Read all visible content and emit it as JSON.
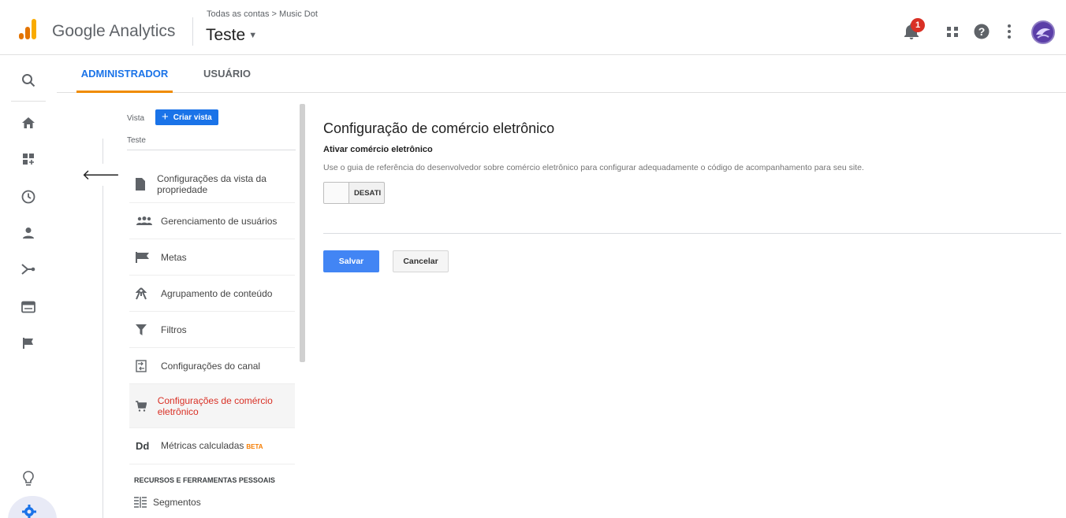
{
  "header": {
    "product_name": "Google Analytics",
    "breadcrumb": "Todas as contas > Music Dot",
    "view_name": "Teste",
    "notification_count": "1",
    "logo_colors": [
      "#F9AB00",
      "#E37400",
      "#E37400"
    ]
  },
  "tabs": {
    "admin": "ADMINISTRADOR",
    "user": "USUÁRIO"
  },
  "view_column": {
    "label": "Vista",
    "create_button": "Criar vista",
    "selected_view": "Teste",
    "menu": [
      {
        "label": "Configurações da vista da propriedade",
        "icon": "document-icon"
      },
      {
        "label": "Gerenciamento de usuários",
        "icon": "users-icon"
      },
      {
        "label": "Metas",
        "icon": "flag-icon"
      },
      {
        "label": "Agrupamento de conteúdo",
        "icon": "content-grouping-icon"
      },
      {
        "label": "Filtros",
        "icon": "filter-icon"
      },
      {
        "label": "Configurações do canal",
        "icon": "channel-settings-icon"
      },
      {
        "label": "Configurações de comércio eletrônico",
        "icon": "cart-icon",
        "active": true
      },
      {
        "label": "Métricas calculadas",
        "icon": "dd-icon",
        "badge": "BETA"
      }
    ],
    "section_header": "RECURSOS E FERRAMENTAS PESSOAIS",
    "segments_label": "Segmentos"
  },
  "main": {
    "title": "Configuração de comércio eletrônico",
    "enable_label": "Ativar comércio eletrônico",
    "description": "Use o guia de referência do desenvolvedor sobre comércio eletrônico para configurar adequadamente o código de acompanhamento para seu site.",
    "toggle_state": "DESATI",
    "save_button": "Salvar",
    "cancel_button": "Cancelar"
  },
  "colors": {
    "accent_blue": "#1A73E8",
    "tab_underline": "#EF8B00",
    "active_item": "#D93025",
    "save_button": "#4285F4"
  }
}
